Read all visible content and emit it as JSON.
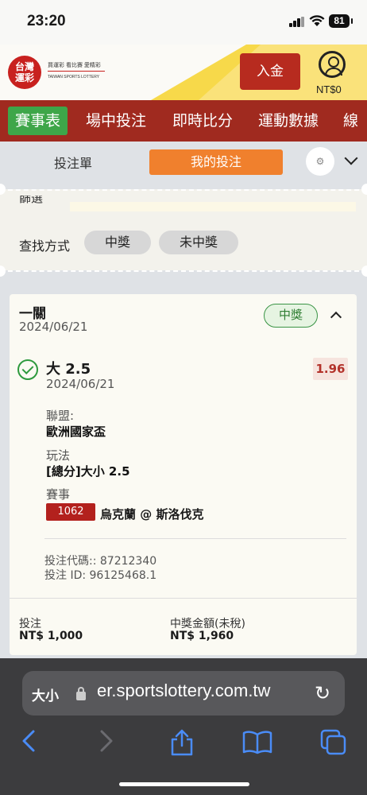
{
  "status_bar": {
    "time": "23:20",
    "battery": "81"
  },
  "header": {
    "logo_chars": "台灣\n運彩",
    "logo_line1": "買運彩 看比賽 愛精彩",
    "logo_line2": "TAIWAN SPORTS LOTTERY",
    "deposit_label": "入金",
    "balance": "NT$0"
  },
  "nav": {
    "items": [
      "賽事表",
      "場中投注",
      "即時比分",
      "運動數據",
      "線"
    ]
  },
  "bet_tabs": {
    "slip_label": "投注單",
    "mine_label": "我的投注"
  },
  "filter": {
    "cutoff_label": "篩選",
    "search_label": "查找方式",
    "chips": [
      "中獎",
      "未中獎"
    ]
  },
  "bet": {
    "title": "一關",
    "date": "2024/06/21",
    "status": "中獎",
    "pick": "大 2.5",
    "pick_date": "2024/06/21",
    "odds": "1.96",
    "league_label": "聯盟:",
    "league": "歐洲國家盃",
    "market_label": "玩法",
    "market": "[總分]大小 2.5",
    "event_label": "賽事",
    "event_id": "1062",
    "event_name": "烏克蘭 @ 斯洛伐克",
    "bet_code": "投注代碼:: 87212340",
    "bet_id": "投注 ID: 96125468.1",
    "stake_label": "投注",
    "stake": "NT$ 1,000",
    "payout_label": "中獎金額(未稅)",
    "payout": "NT$ 1,960"
  },
  "browser": {
    "text_size_label": "大小",
    "url": "er.sportslottery.com.tw"
  }
}
